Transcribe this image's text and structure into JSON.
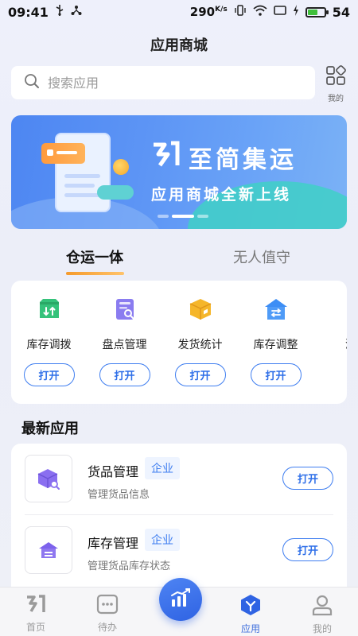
{
  "status_bar": {
    "time": "09:41",
    "speed_value": "290",
    "speed_unit": "K/s",
    "battery": "54",
    "battery_fill": 0.54
  },
  "header": {
    "title": "应用商城"
  },
  "search": {
    "placeholder": "搜索应用",
    "mine_label": "我的"
  },
  "banner": {
    "brand": "至简集运",
    "slogan": "应用商城全新上线"
  },
  "tabs": [
    {
      "label": "仓运一体",
      "active": true
    },
    {
      "label": "无人值守",
      "active": false
    }
  ],
  "apps": [
    {
      "name": "库存调拨",
      "button": "打开",
      "icon": "inventory-transfer-icon"
    },
    {
      "name": "盘点管理",
      "button": "打开",
      "icon": "stocktake-icon"
    },
    {
      "name": "发货统计",
      "button": "打开",
      "icon": "shipment-box-icon"
    },
    {
      "name": "库存调整",
      "button": "打开",
      "icon": "inventory-adjust-icon"
    },
    {
      "name": "溢损",
      "button": "打",
      "icon": "overflow-loss-icon"
    }
  ],
  "latest": {
    "title": "最新应用",
    "items": [
      {
        "name": "货品管理",
        "tag": "企业",
        "desc": "管理货品信息",
        "button": "打开",
        "icon": "goods-cube-icon"
      },
      {
        "name": "库存管理",
        "tag": "企业",
        "desc": "管理货品库存状态",
        "button": "打开",
        "icon": "warehouse-icon"
      }
    ]
  },
  "bottom_nav": {
    "items": [
      {
        "label": "首页",
        "active": false
      },
      {
        "label": "待办",
        "active": false
      },
      {
        "label": "应用",
        "active": true
      },
      {
        "label": "我的",
        "active": false
      }
    ]
  },
  "colors": {
    "accent": "#3f7ef0",
    "tab_underline": "#f59a2b",
    "banner": "#5d95f5"
  }
}
